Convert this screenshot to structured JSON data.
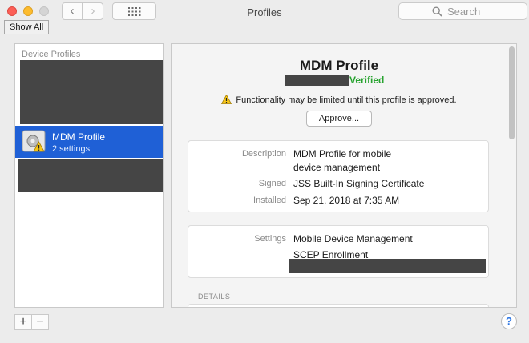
{
  "window": {
    "title": "Profiles",
    "search_placeholder": "Search",
    "tooltip": "Show All"
  },
  "toolbar": {
    "back_label": "‹",
    "forward_label": "›"
  },
  "sidebar": {
    "header": "Device Profiles",
    "selected": {
      "name": "MDM Profile",
      "subtitle": "2 settings"
    },
    "add_label": "+",
    "remove_label": "−"
  },
  "profile": {
    "title": "MDM Profile",
    "status": "Verified",
    "warning": "Functionality may be limited until this profile is approved.",
    "approve_label": "Approve...",
    "description_label": "Description",
    "description_line1": "MDM Profile for mobile",
    "description_line2": "device management",
    "signed_label": "Signed",
    "signed_value": "JSS Built-In Signing Certificate",
    "installed_label": "Installed",
    "installed_value": "Sep 21, 2018 at 7:35 AM",
    "settings_label": "Settings",
    "settings_items": [
      "Mobile Device Management",
      "SCEP Enrollment"
    ],
    "details_header": "DETAILS"
  },
  "help_label": "?",
  "colors": {
    "selection": "#1f60d6",
    "verified": "#27a32f",
    "redaction": "#454545"
  }
}
